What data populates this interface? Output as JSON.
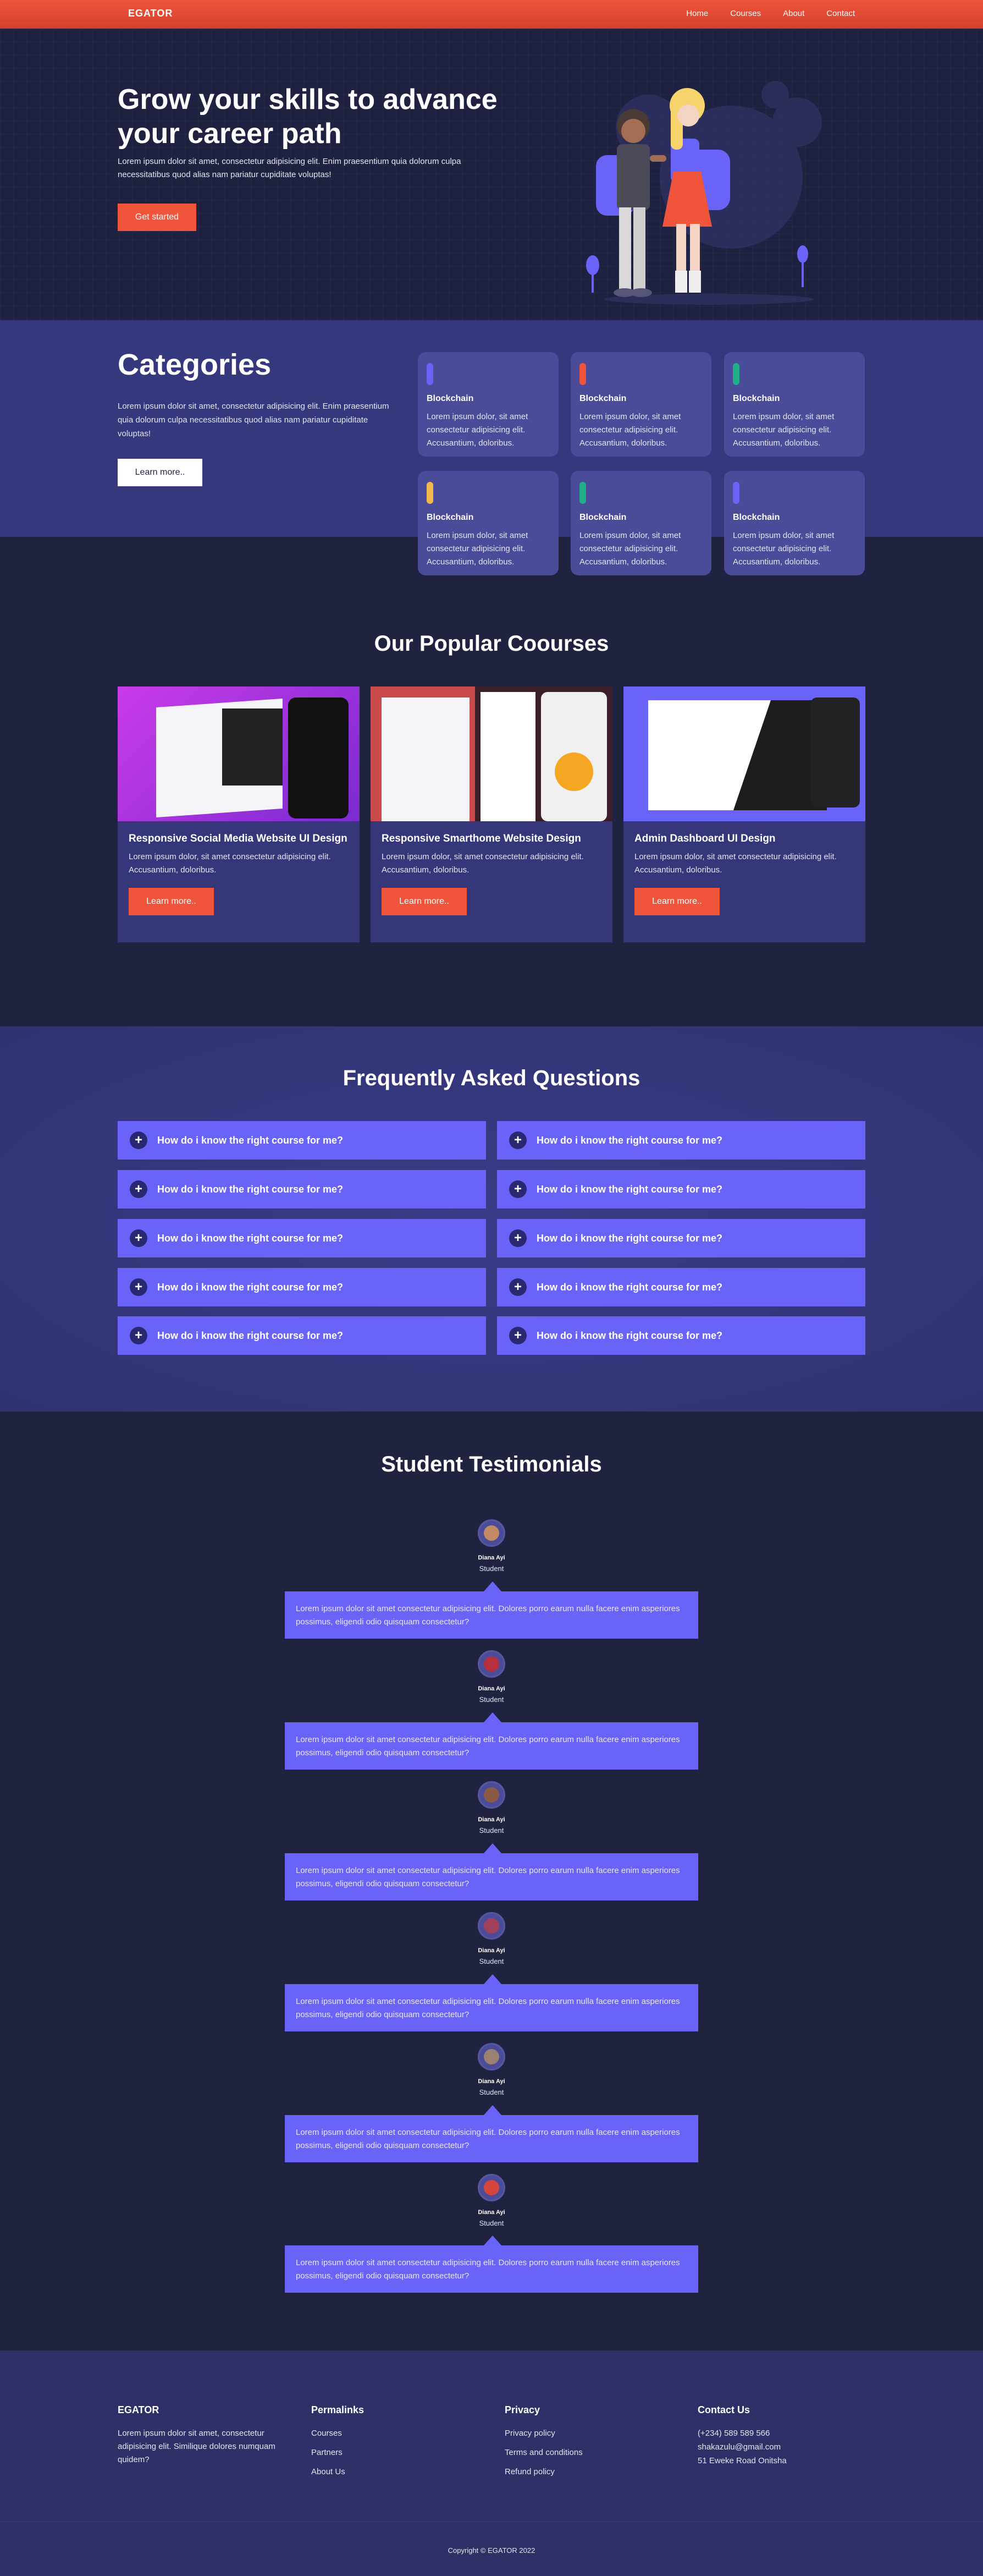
{
  "nav": {
    "brand": "EGATOR",
    "links": [
      "Home",
      "Courses",
      "About",
      "Contact"
    ]
  },
  "hero": {
    "title": "Grow your skills to advance your career path",
    "text": "Lorem ipsum dolor sit amet, consectetur adipisicing elit. Enim praesentium quia dolorum culpa necessitatibus quod alias nam pariatur cupiditate voluptas!",
    "cta": "Get started"
  },
  "categories": {
    "title": "Categories",
    "text": "Lorem ipsum dolor sit amet, consectetur adipisicing elit. Enim praesentium quia dolorum culpa necessitatibus quod alias nam pariatur cupiditate voluptas!",
    "cta": "Learn more..",
    "items": [
      {
        "title": "Blockchain",
        "text": "Lorem ipsum dolor, sit amet consectetur adipisicing elit. Accusantium, doloribus.",
        "color": "#6a63f7"
      },
      {
        "title": "Blockchain",
        "text": "Lorem ipsum dolor, sit amet consectetur adipisicing elit. Accusantium, doloribus.",
        "color": "#f0553c"
      },
      {
        "title": "Blockchain",
        "text": "Lorem ipsum dolor, sit amet consectetur adipisicing elit. Accusantium, doloribus.",
        "color": "#1fb08a"
      },
      {
        "title": "Blockchain",
        "text": "Lorem ipsum dolor, sit amet consectetur adipisicing elit. Accusantium, doloribus.",
        "color": "#f2b84b"
      },
      {
        "title": "Blockchain",
        "text": "Lorem ipsum dolor, sit amet consectetur adipisicing elit. Accusantium, doloribus.",
        "color": "#1fb08a"
      },
      {
        "title": "Blockchain",
        "text": "Lorem ipsum dolor, sit amet consectetur adipisicing elit. Accusantium, doloribus.",
        "color": "#6a63f7"
      }
    ]
  },
  "courses": {
    "title": "Our Popular Coourses",
    "items": [
      {
        "title": "Responsive Social Media Website UI Design",
        "text": "Lorem ipsum dolor, sit amet consectetur adipisicing elit. Accusantium, doloribus.",
        "cta": "Learn more.."
      },
      {
        "title": "Responsive Smarthome Website Design",
        "text": "Lorem ipsum dolor, sit amet consectetur adipisicing elit. Accusantium, doloribus.",
        "cta": "Learn more.."
      },
      {
        "title": "Admin Dashboard UI Design",
        "text": "Lorem ipsum dolor, sit amet consectetur adipisicing elit. Accusantium, doloribus.",
        "cta": "Learn more.."
      }
    ]
  },
  "faq": {
    "title": "Frequently Asked Questions",
    "icon": "plus-icon",
    "items": [
      "How do i know the right course for me?",
      "How do i know the right course for me?",
      "How do i know the right course for me?",
      "How do i know the right course for me?",
      "How do i know the right course for me?",
      "How do i know the right course for me?",
      "How do i know the right course for me?",
      "How do i know the right course for me?",
      "How do i know the right course for me?",
      "How do i know the right course for me?"
    ]
  },
  "testimonials": {
    "title": "Student Testimonials",
    "items": [
      {
        "name": "Diana Ayi",
        "role": "Student",
        "text": "Lorem ipsum dolor sit amet consectetur adipisicing elit. Dolores porro earum nulla facere enim asperiores possimus, eligendi odio quisquam consectetur?"
      },
      {
        "name": "Diana Ayi",
        "role": "Student",
        "text": "Lorem ipsum dolor sit amet consectetur adipisicing elit. Dolores porro earum nulla facere enim asperiores possimus, eligendi odio quisquam consectetur?"
      },
      {
        "name": "Diana Ayi",
        "role": "Student",
        "text": "Lorem ipsum dolor sit amet consectetur adipisicing elit. Dolores porro earum nulla facere enim asperiores possimus, eligendi odio quisquam consectetur?"
      },
      {
        "name": "Diana Ayi",
        "role": "Student",
        "text": "Lorem ipsum dolor sit amet consectetur adipisicing elit. Dolores porro earum nulla facere enim asperiores possimus, eligendi odio quisquam consectetur?"
      },
      {
        "name": "Diana Ayi",
        "role": "Student",
        "text": "Lorem ipsum dolor sit amet consectetur adipisicing elit. Dolores porro earum nulla facere enim asperiores possimus, eligendi odio quisquam consectetur?"
      },
      {
        "name": "Diana Ayi",
        "role": "Student",
        "text": "Lorem ipsum dolor sit amet consectetur adipisicing elit. Dolores porro earum nulla facere enim asperiores possimus, eligendi odio quisquam consectetur?"
      }
    ]
  },
  "footer": {
    "brand": "EGATOR",
    "about": "Lorem ipsum dolor sit amet, consectetur adipisicing elit. Similique dolores numquam quidem?",
    "permalinks": {
      "title": "Permalinks",
      "links": [
        "Courses",
        "Partners",
        "About Us"
      ]
    },
    "privacy": {
      "title": "Privacy",
      "links": [
        "Privacy policy",
        "Terms and conditions",
        "Refund policy"
      ]
    },
    "contact": {
      "title": "Contact Us",
      "phone": "(+234) 589 589 566",
      "email": "shakazulu@gmail.com",
      "address": "51 Eweke Road Onitsha"
    },
    "copyright": "Copyright © EGATOR 2022"
  },
  "colors": {
    "accent": "#f0553c",
    "primary": "#6a63f7",
    "bg": "#1f2340",
    "band": "#36387e"
  }
}
